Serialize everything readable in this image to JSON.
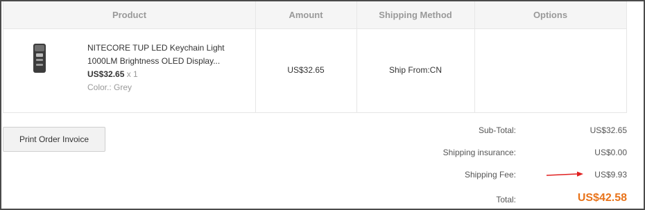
{
  "table": {
    "headers": {
      "product": "Product",
      "amount": "Amount",
      "shipping_method": "Shipping Method",
      "options": "Options"
    },
    "row": {
      "image_icon": "flashlight-image",
      "name": "NITECORE TUP LED Keychain Light 1000LM Brightness OLED Display...",
      "price": "US$32.65",
      "qty": "x 1",
      "color": "Color.: Grey",
      "amount": "US$32.65",
      "shipping": "Ship From:CN",
      "options": ""
    }
  },
  "actions": {
    "print_invoice": "Print Order Invoice"
  },
  "summary": {
    "subtotal_label": "Sub-Total:",
    "subtotal_value": "US$32.65",
    "insurance_label": "Shipping insurance:",
    "insurance_value": "US$0.00",
    "fee_label": "Shipping Fee:",
    "fee_value": "US$9.93",
    "total_label": "Total:",
    "total_value": "US$42.58"
  },
  "colors": {
    "total_accent": "#e8731a",
    "annotation_arrow": "#e02020"
  }
}
